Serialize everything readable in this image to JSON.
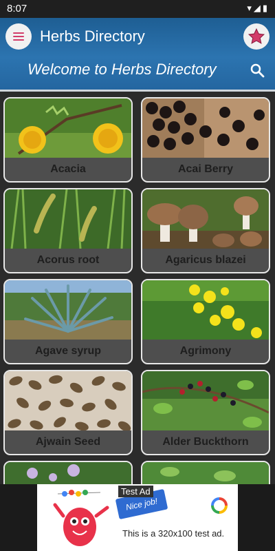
{
  "status": {
    "time": "8:07",
    "icons": "▾◢▮"
  },
  "header": {
    "title": "Herbs Directory",
    "welcome": "Welcome to Herbs Directory"
  },
  "herbs": [
    {
      "name": "Acacia"
    },
    {
      "name": "Acai Berry"
    },
    {
      "name": "Acorus root"
    },
    {
      "name": "Agaricus blazei"
    },
    {
      "name": "Agave syrup"
    },
    {
      "name": "Agrimony"
    },
    {
      "name": "Ajwain Seed"
    },
    {
      "name": "Alder Buckthorn"
    },
    {
      "name": ""
    },
    {
      "name": ""
    }
  ],
  "ad": {
    "badge": "Test Ad",
    "text": "This is a 320x100 test ad.",
    "nice": "Nice job!"
  },
  "colors": {
    "accent": "#d23b69",
    "header": "#2c74b0"
  }
}
